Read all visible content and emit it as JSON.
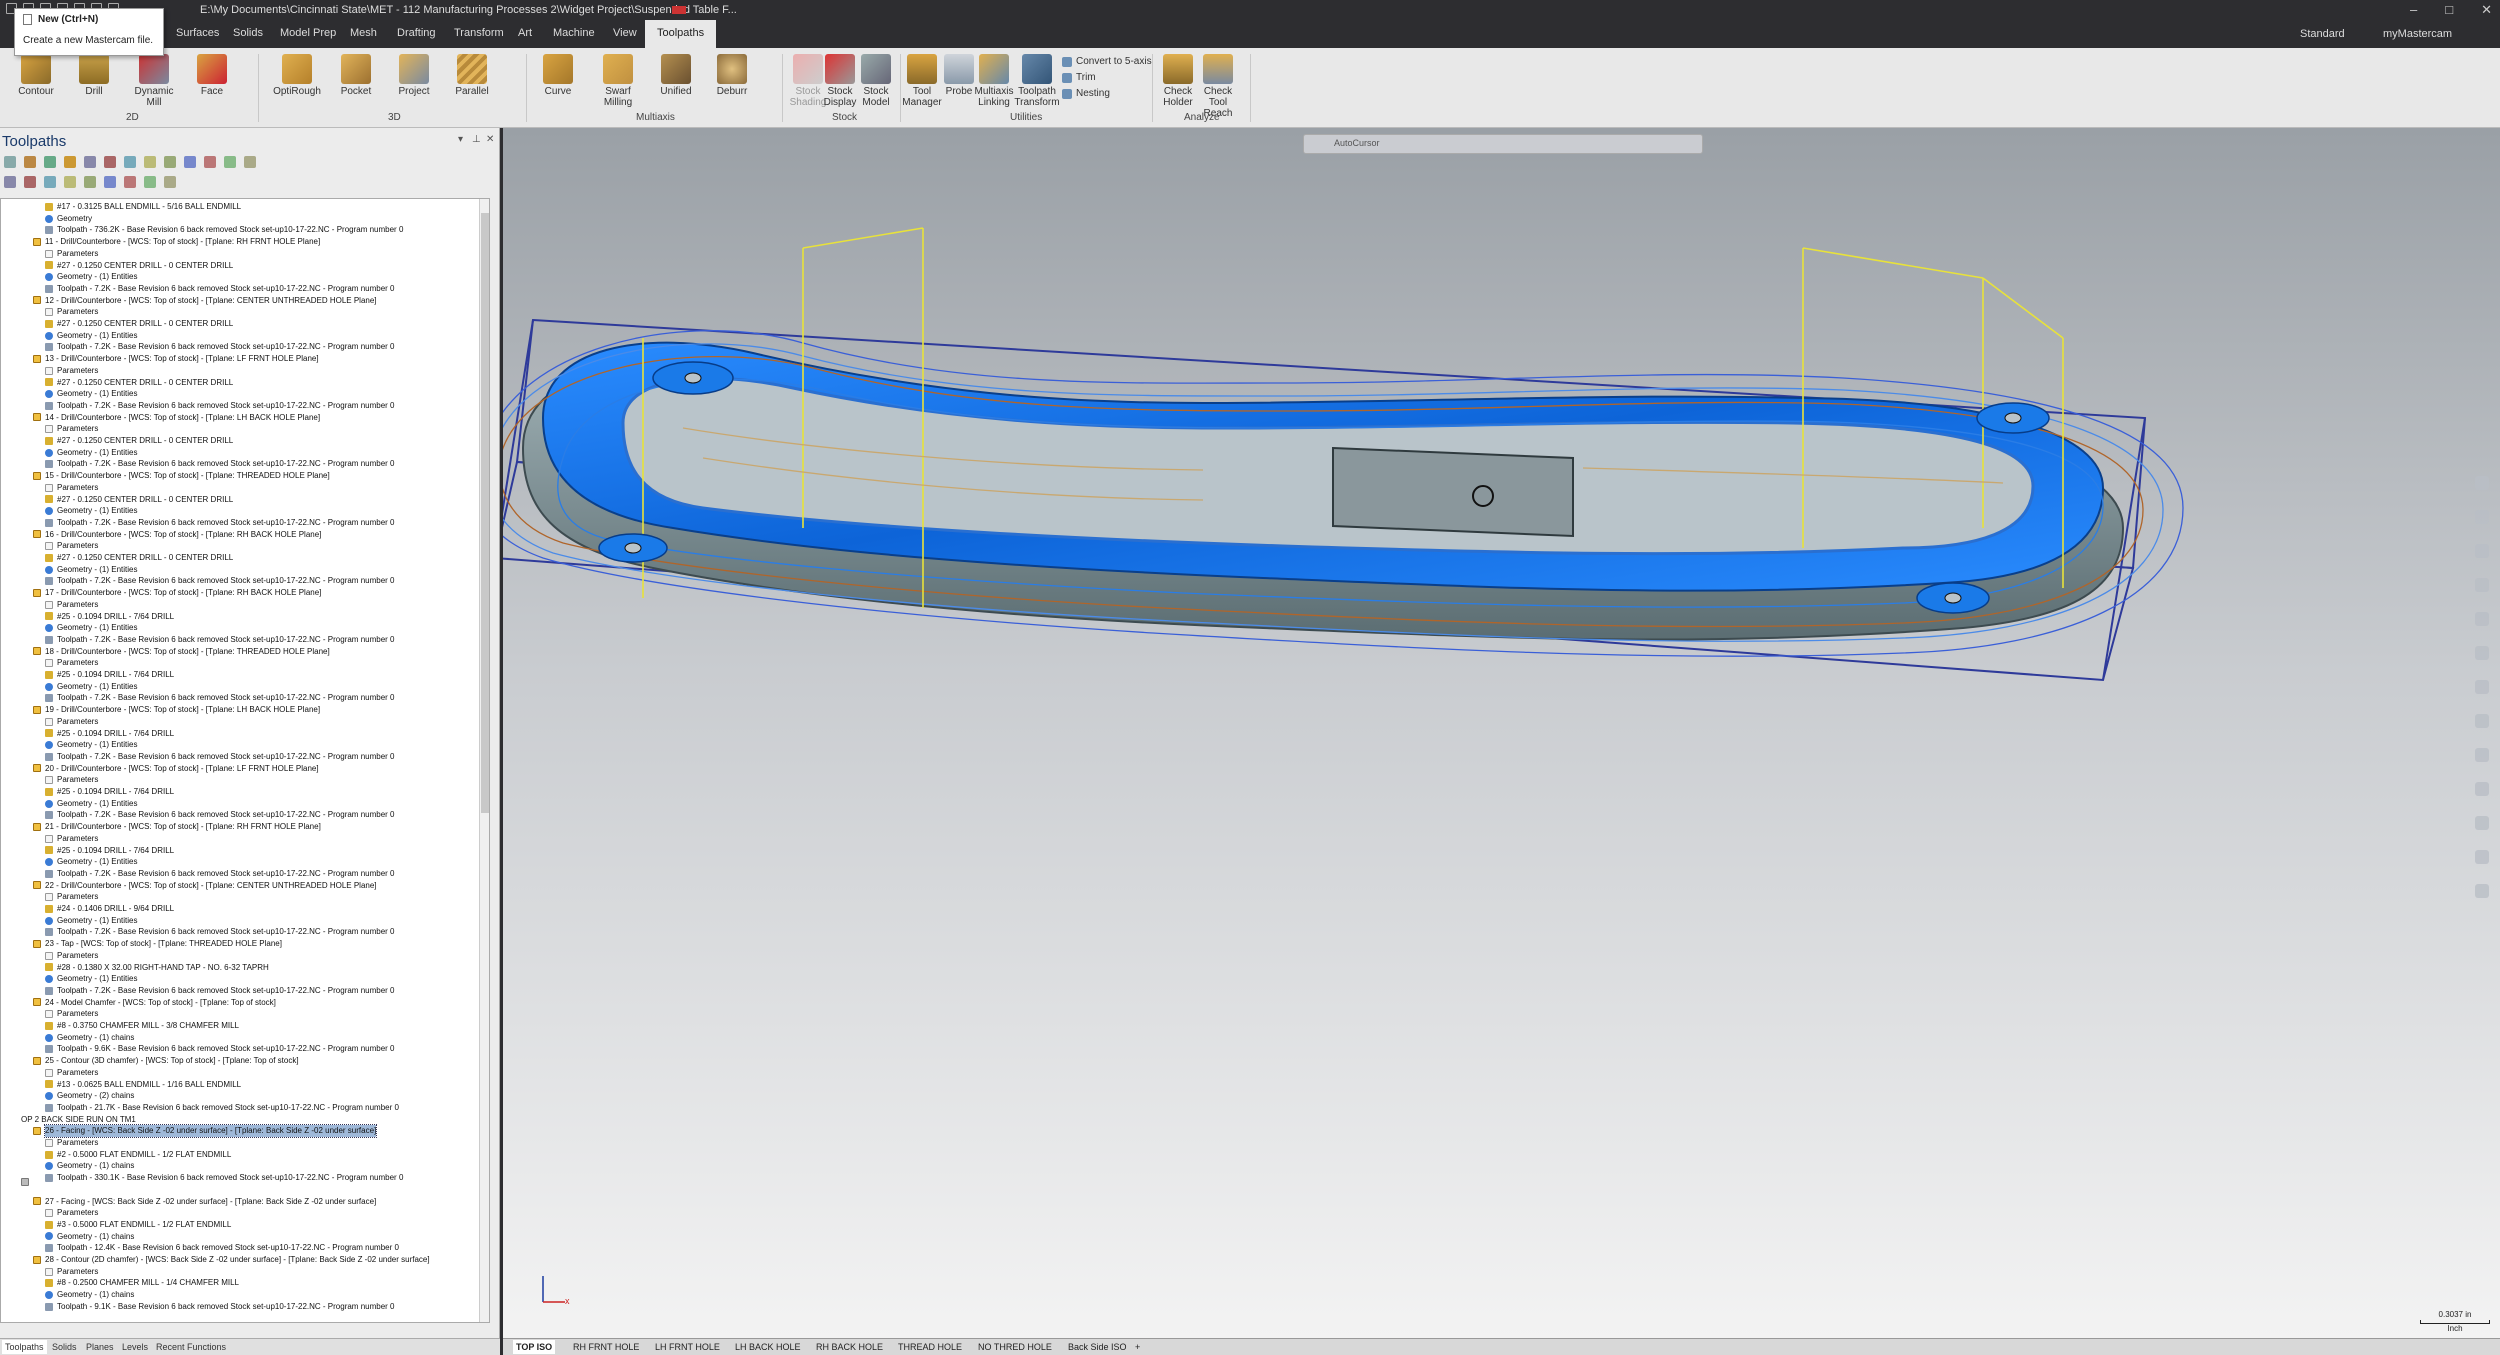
{
  "titlebar": {
    "title": "E:\\My Documents\\Cincinnati State\\MET - 112 Manufacturing Processes 2\\Widget Project\\Suspended Table F...",
    "window_buttons": [
      "–",
      "□",
      "✕"
    ]
  },
  "tooltip": {
    "title": "New (Ctrl+N)",
    "description": "Create a new Mastercam file."
  },
  "tabs": [
    {
      "label": "Surfaces"
    },
    {
      "label": "Solids"
    },
    {
      "label": "Model Prep"
    },
    {
      "label": "Mesh"
    },
    {
      "label": "Drafting"
    },
    {
      "label": "Transform"
    },
    {
      "label": "Art"
    },
    {
      "label": "Machine"
    },
    {
      "label": "View"
    },
    {
      "label": "Toolpaths"
    }
  ],
  "tabbar_right": {
    "workspace": "Standard",
    "account": "myMastercam"
  },
  "ribbon": {
    "buttons": [
      {
        "label": "Contour"
      },
      {
        "label": "Drill"
      },
      {
        "label": "Dynamic Mill"
      },
      {
        "label": "Face"
      },
      {
        "label": "OptiRough"
      },
      {
        "label": "Pocket"
      },
      {
        "label": "Project"
      },
      {
        "label": "Parallel"
      },
      {
        "label": "Curve"
      },
      {
        "label": "Swarf Milling"
      },
      {
        "label": "Unified"
      },
      {
        "label": "Deburr"
      },
      {
        "label": "Stock Shading"
      },
      {
        "label": "Stock Display"
      },
      {
        "label": "Stock Model"
      },
      {
        "label": "Tool Manager"
      },
      {
        "label": "Probe"
      },
      {
        "label": "Multiaxis Linking"
      },
      {
        "label": "Toolpath Transform"
      },
      {
        "label": "Check Holder"
      },
      {
        "label": "Check Tool Reach"
      }
    ],
    "small_buttons": [
      {
        "label": "Convert to 5-axis"
      },
      {
        "label": "Trim"
      },
      {
        "label": "Nesting"
      }
    ],
    "groups": [
      {
        "label": "2D"
      },
      {
        "label": "3D"
      },
      {
        "label": "Multiaxis"
      },
      {
        "label": "Stock"
      },
      {
        "label": "Utilities"
      },
      {
        "label": "Analyze"
      }
    ]
  },
  "panel": {
    "title": "Toolpaths",
    "buttons": [
      "▾",
      "⊥",
      "✕"
    ]
  },
  "tree": [
    {
      "indent": 3,
      "icon": "tool",
      "text": "#17 - 0.3125 BALL ENDMILL - 5/16 BALL ENDMILL"
    },
    {
      "indent": 3,
      "icon": "geo",
      "text": "Geometry"
    },
    {
      "indent": 3,
      "icon": "tp",
      "text": "Toolpath - 736.2K - Base Revision 6 back removed Stock set-up10-17-22.NC - Program number 0"
    },
    {
      "indent": 2,
      "icon": "op",
      "text": "11 - Drill/Counterbore - [WCS: Top of stock] - [Tplane: RH FRNT HOLE Plane]"
    },
    {
      "indent": 3,
      "icon": "par",
      "text": "Parameters"
    },
    {
      "indent": 3,
      "icon": "tool",
      "text": "#27 - 0.1250 CENTER DRILL - 0 CENTER DRILL"
    },
    {
      "indent": 3,
      "icon": "geo",
      "text": "Geometry - (1) Entities"
    },
    {
      "indent": 3,
      "icon": "tp",
      "text": "Toolpath - 7.2K - Base Revision 6 back removed Stock set-up10-17-22.NC - Program number 0"
    },
    {
      "indent": 2,
      "icon": "op",
      "text": "12 - Drill/Counterbore - [WCS: Top of stock] - [Tplane: CENTER UNTHREADED HOLE Plane]"
    },
    {
      "indent": 3,
      "icon": "par",
      "text": "Parameters"
    },
    {
      "indent": 3,
      "icon": "tool",
      "text": "#27 - 0.1250 CENTER DRILL - 0 CENTER DRILL"
    },
    {
      "indent": 3,
      "icon": "geo",
      "text": "Geometry - (1) Entities"
    },
    {
      "indent": 3,
      "icon": "tp",
      "text": "Toolpath - 7.2K - Base Revision 6 back removed Stock set-up10-17-22.NC - Program number 0"
    },
    {
      "indent": 2,
      "icon": "op",
      "text": "13 - Drill/Counterbore - [WCS: Top of stock] - [Tplane: LF FRNT HOLE Plane]"
    },
    {
      "indent": 3,
      "icon": "par",
      "text": "Parameters"
    },
    {
      "indent": 3,
      "icon": "tool",
      "text": "#27 - 0.1250 CENTER DRILL - 0 CENTER DRILL"
    },
    {
      "indent": 3,
      "icon": "geo",
      "text": "Geometry - (1) Entities"
    },
    {
      "indent": 3,
      "icon": "tp",
      "text": "Toolpath - 7.2K - Base Revision 6 back removed Stock set-up10-17-22.NC - Program number 0"
    },
    {
      "indent": 2,
      "icon": "op",
      "text": "14 - Drill/Counterbore - [WCS: Top of stock] - [Tplane: LH BACK HOLE Plane]"
    },
    {
      "indent": 3,
      "icon": "par",
      "text": "Parameters"
    },
    {
      "indent": 3,
      "icon": "tool",
      "text": "#27 - 0.1250 CENTER DRILL - 0 CENTER DRILL"
    },
    {
      "indent": 3,
      "icon": "geo",
      "text": "Geometry - (1) Entities"
    },
    {
      "indent": 3,
      "icon": "tp",
      "text": "Toolpath - 7.2K - Base Revision 6 back removed Stock set-up10-17-22.NC - Program number 0"
    },
    {
      "indent": 2,
      "icon": "op",
      "text": "15 - Drill/Counterbore - [WCS: Top of stock] - [Tplane: THREADED HOLE Plane]"
    },
    {
      "indent": 3,
      "icon": "par",
      "text": "Parameters"
    },
    {
      "indent": 3,
      "icon": "tool",
      "text": "#27 - 0.1250 CENTER DRILL - 0 CENTER DRILL"
    },
    {
      "indent": 3,
      "icon": "geo",
      "text": "Geometry - (1) Entities"
    },
    {
      "indent": 3,
      "icon": "tp",
      "text": "Toolpath - 7.2K - Base Revision 6 back removed Stock set-up10-17-22.NC - Program number 0"
    },
    {
      "indent": 2,
      "icon": "op",
      "text": "16 - Drill/Counterbore - [WCS: Top of stock] - [Tplane: RH BACK HOLE Plane]"
    },
    {
      "indent": 3,
      "icon": "par",
      "text": "Parameters"
    },
    {
      "indent": 3,
      "icon": "tool",
      "text": "#27 - 0.1250 CENTER DRILL - 0 CENTER DRILL"
    },
    {
      "indent": 3,
      "icon": "geo",
      "text": "Geometry - (1) Entities"
    },
    {
      "indent": 3,
      "icon": "tp",
      "text": "Toolpath - 7.2K - Base Revision 6 back removed Stock set-up10-17-22.NC - Program number 0"
    },
    {
      "indent": 2,
      "icon": "op",
      "text": "17 - Drill/Counterbore - [WCS: Top of stock] - [Tplane: RH BACK HOLE Plane]"
    },
    {
      "indent": 3,
      "icon": "par",
      "text": "Parameters"
    },
    {
      "indent": 3,
      "icon": "tool",
      "text": "#25 - 0.1094 DRILL - 7/64 DRILL"
    },
    {
      "indent": 3,
      "icon": "geo",
      "text": "Geometry - (1) Entities"
    },
    {
      "indent": 3,
      "icon": "tp",
      "text": "Toolpath - 7.2K - Base Revision 6 back removed Stock set-up10-17-22.NC - Program number 0"
    },
    {
      "indent": 2,
      "icon": "op",
      "text": "18 - Drill/Counterbore - [WCS: Top of stock] - [Tplane: THREADED HOLE Plane]"
    },
    {
      "indent": 3,
      "icon": "par",
      "text": "Parameters"
    },
    {
      "indent": 3,
      "icon": "tool",
      "text": "#25 - 0.1094 DRILL - 7/64 DRILL"
    },
    {
      "indent": 3,
      "icon": "geo",
      "text": "Geometry - (1) Entities"
    },
    {
      "indent": 3,
      "icon": "tp",
      "text": "Toolpath - 7.2K - Base Revision 6 back removed Stock set-up10-17-22.NC - Program number 0"
    },
    {
      "indent": 2,
      "icon": "op",
      "text": "19 - Drill/Counterbore - [WCS: Top of stock] - [Tplane: LH BACK HOLE Plane]"
    },
    {
      "indent": 3,
      "icon": "par",
      "text": "Parameters"
    },
    {
      "indent": 3,
      "icon": "tool",
      "text": "#25 - 0.1094 DRILL - 7/64 DRILL"
    },
    {
      "indent": 3,
      "icon": "geo",
      "text": "Geometry - (1) Entities"
    },
    {
      "indent": 3,
      "icon": "tp",
      "text": "Toolpath - 7.2K - Base Revision 6 back removed Stock set-up10-17-22.NC - Program number 0"
    },
    {
      "indent": 2,
      "icon": "op",
      "text": "20 - Drill/Counterbore - [WCS: Top of stock] - [Tplane: LF FRNT HOLE Plane]"
    },
    {
      "indent": 3,
      "icon": "par",
      "text": "Parameters"
    },
    {
      "indent": 3,
      "icon": "tool",
      "text": "#25 - 0.1094 DRILL - 7/64 DRILL"
    },
    {
      "indent": 3,
      "icon": "geo",
      "text": "Geometry - (1) Entities"
    },
    {
      "indent": 3,
      "icon": "tp",
      "text": "Toolpath - 7.2K - Base Revision 6 back removed Stock set-up10-17-22.NC - Program number 0"
    },
    {
      "indent": 2,
      "icon": "op",
      "text": "21 - Drill/Counterbore - [WCS: Top of stock] - [Tplane: RH FRNT HOLE Plane]"
    },
    {
      "indent": 3,
      "icon": "par",
      "text": "Parameters"
    },
    {
      "indent": 3,
      "icon": "tool",
      "text": "#25 - 0.1094 DRILL - 7/64 DRILL"
    },
    {
      "indent": 3,
      "icon": "geo",
      "text": "Geometry - (1) Entities"
    },
    {
      "indent": 3,
      "icon": "tp",
      "text": "Toolpath - 7.2K - Base Revision 6 back removed Stock set-up10-17-22.NC - Program number 0"
    },
    {
      "indent": 2,
      "icon": "op",
      "text": "22 - Drill/Counterbore - [WCS: Top of stock] - [Tplane: CENTER UNTHREADED HOLE Plane]"
    },
    {
      "indent": 3,
      "icon": "par",
      "text": "Parameters"
    },
    {
      "indent": 3,
      "icon": "tool",
      "text": "#24 - 0.1406 DRILL - 9/64 DRILL"
    },
    {
      "indent": 3,
      "icon": "geo",
      "text": "Geometry - (1) Entities"
    },
    {
      "indent": 3,
      "icon": "tp",
      "text": "Toolpath - 7.2K - Base Revision 6 back removed Stock set-up10-17-22.NC - Program number 0"
    },
    {
      "indent": 2,
      "icon": "op",
      "text": "23 - Tap - [WCS: Top of stock] - [Tplane: THREADED HOLE Plane]"
    },
    {
      "indent": 3,
      "icon": "par",
      "text": "Parameters"
    },
    {
      "indent": 3,
      "icon": "tool",
      "text": "#28 - 0.1380 X 32.00 RIGHT-HAND TAP - NO. 6-32 TAPRH"
    },
    {
      "indent": 3,
      "icon": "geo",
      "text": "Geometry - (1) Entities"
    },
    {
      "indent": 3,
      "icon": "tp",
      "text": "Toolpath - 7.2K - Base Revision 6 back removed Stock set-up10-17-22.NC - Program number 0"
    },
    {
      "indent": 2,
      "icon": "op",
      "text": "24 - Model Chamfer - [WCS: Top of stock] - [Tplane: Top of stock]"
    },
    {
      "indent": 3,
      "icon": "par",
      "text": "Parameters"
    },
    {
      "indent": 3,
      "icon": "tool",
      "text": "#8 - 0.3750 CHAMFER MILL - 3/8 CHAMFER MILL"
    },
    {
      "indent": 3,
      "icon": "geo",
      "text": "Geometry - (1) chains"
    },
    {
      "indent": 3,
      "icon": "tp",
      "text": "Toolpath - 9.6K - Base Revision 6 back removed Stock set-up10-17-22.NC - Program number 0"
    },
    {
      "indent": 2,
      "icon": "op",
      "text": "25 - Contour (3D chamfer) - [WCS: Top of stock] - [Tplane: Top of stock]"
    },
    {
      "indent": 3,
      "icon": "par",
      "text": "Parameters"
    },
    {
      "indent": 3,
      "icon": "tool",
      "text": "#13 - 0.0625 BALL ENDMILL - 1/16 BALL ENDMILL"
    },
    {
      "indent": 3,
      "icon": "geo",
      "text": "Geometry - (2) chains"
    },
    {
      "indent": 3,
      "icon": "tp",
      "text": "Toolpath - 21.7K - Base Revision 6 back removed Stock set-up10-17-22.NC - Program number 0"
    },
    {
      "indent": 1,
      "icon": "grp",
      "text": "OP 2 BACK SIDE RUN ON TM1"
    },
    {
      "indent": 2,
      "icon": "op",
      "text": "26 - Facing - [WCS: Back Side Z -02 under surface] - [Tplane: Back Side Z -02 under surface]",
      "selected": true
    },
    {
      "indent": 3,
      "icon": "par",
      "text": "Parameters"
    },
    {
      "indent": 3,
      "icon": "tool",
      "text": "#2 - 0.5000 FLAT ENDMILL - 1/2 FLAT ENDMILL"
    },
    {
      "indent": 3,
      "icon": "geo",
      "text": "Geometry - (1) chains"
    },
    {
      "indent": 3,
      "icon": "tp",
      "text": "Toolpath - 330.1K - Base Revision 6 back removed Stock set-up10-17-22.NC - Program number 0"
    },
    {
      "indent": 2,
      "icon": "none",
      "text": ""
    },
    {
      "indent": 2,
      "icon": "op",
      "text": "27 - Facing - [WCS: Back Side Z -02 under surface] - [Tplane: Back Side Z -02 under surface]"
    },
    {
      "indent": 3,
      "icon": "par",
      "text": "Parameters"
    },
    {
      "indent": 3,
      "icon": "tool",
      "text": "#3 - 0.5000 FLAT ENDMILL - 1/2 FLAT ENDMILL"
    },
    {
      "indent": 3,
      "icon": "geo",
      "text": "Geometry - (1) chains"
    },
    {
      "indent": 3,
      "icon": "tp",
      "text": "Toolpath - 12.4K - Base Revision 6 back removed Stock set-up10-17-22.NC - Program number 0"
    },
    {
      "indent": 2,
      "icon": "op",
      "text": "28 - Contour (2D chamfer) - [WCS: Back Side Z -02 under surface] - [Tplane: Back Side Z -02 under surface]"
    },
    {
      "indent": 3,
      "icon": "par",
      "text": "Parameters"
    },
    {
      "indent": 3,
      "icon": "tool",
      "text": "#8 - 0.2500 CHAMFER MILL - 1/4 CHAMFER MILL"
    },
    {
      "indent": 3,
      "icon": "geo",
      "text": "Geometry - (1) chains"
    },
    {
      "indent": 3,
      "icon": "tp",
      "text": "Toolpath - 9.1K - Base Revision 6 back removed Stock set-up10-17-22.NC - Program number 0"
    }
  ],
  "left_tabs": [
    {
      "label": "Toolpaths",
      "active": true
    },
    {
      "label": "Solids"
    },
    {
      "label": "Planes"
    },
    {
      "label": "Levels"
    },
    {
      "label": "Recent Functions"
    }
  ],
  "viewport": {
    "autocursor": "AutoCursor",
    "axis_x": "x",
    "scale_value": "0.3037 in",
    "scale_unit": "Inch",
    "view_tabs": [
      {
        "label": "TOP ISO",
        "active": true
      },
      {
        "label": "RH FRNT HOLE"
      },
      {
        "label": "LH FRNT HOLE"
      },
      {
        "label": "LH BACK HOLE"
      },
      {
        "label": "RH BACK HOLE"
      },
      {
        "label": "THREAD HOLE"
      },
      {
        "label": "NO THRED HOLE"
      },
      {
        "label": "Back Side ISO"
      },
      {
        "label": "+"
      }
    ]
  },
  "colors": {
    "accent_tab": "#e8e8e8",
    "selection": "#9fb9d9",
    "part_blue": "#1e7fe8",
    "toolpath_yellow": "#e8e23a"
  }
}
